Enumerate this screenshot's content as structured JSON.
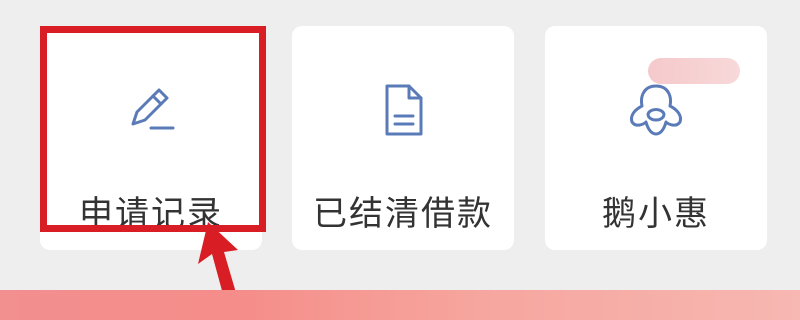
{
  "cards": [
    {
      "label": "申请记录",
      "icon": "pen-icon"
    },
    {
      "label": "已结清借款",
      "icon": "document-icon"
    },
    {
      "label": "鹅小惠",
      "icon": "penguin-icon"
    }
  ],
  "colors": {
    "highlight": "#d81e24",
    "icon": "#5b7bb8",
    "text": "#333333",
    "background": "#eeeeee",
    "banner": "#f28f8f"
  }
}
